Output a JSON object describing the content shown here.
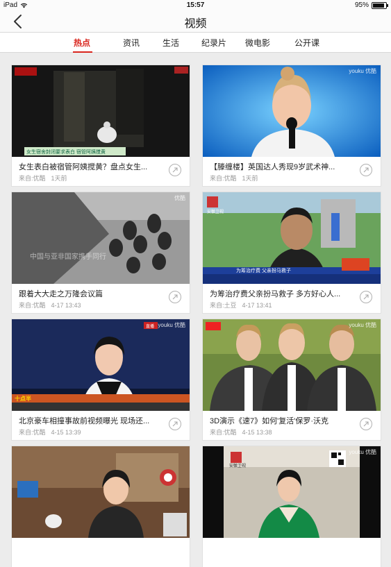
{
  "status": {
    "device": "iPad",
    "time": "15:57",
    "battery": "95%"
  },
  "nav": {
    "title": "视频",
    "back_icon": "chevron-left-icon"
  },
  "tabs": [
    {
      "label": "热点",
      "active": true
    },
    {
      "label": "资讯"
    },
    {
      "label": "生活"
    },
    {
      "label": "纪录片"
    },
    {
      "label": "微电影"
    },
    {
      "label": "公开课"
    }
  ],
  "accent_color": "#d9251d",
  "videos": [
    {
      "title": "女生表白被宿管阿姨搅黄？盘点女生...",
      "source": "来自:优酷",
      "time": "1天前",
      "caption": "女生宿舍封闭要求表白 宿管阿姨搅黄"
    },
    {
      "title": "【滕缠楼】英国达人秀现9岁武术神...",
      "source": "来自:优酷",
      "time": "1天前",
      "watermark": "youku 优酷"
    },
    {
      "title": "跟着大大走之万隆会议篇",
      "source": "来自:优酷",
      "time": "4-17 13:43",
      "watermark": "优酷",
      "caption": "中国与亚非国家携手同行"
    },
    {
      "title": "为筹治疗费父亲扮马救子 多方好心人...",
      "source": "来自:土豆",
      "time": "4-17 13:41",
      "channel": "安徽卫视",
      "caption": "为筹治疗费 父亲扮马救子"
    },
    {
      "title": "北京豪车相撞事故前视频曝光 现场还...",
      "source": "来自:优酷",
      "time": "4-15 13:39",
      "watermark": "youku 优酷",
      "badge": "直播",
      "caption": "十点半"
    },
    {
      "title": "3D演示《速7》如何'复活'保罗·沃克",
      "source": "来自:优酷",
      "time": "4-15 13:38",
      "watermark": "youku 优酷"
    },
    {
      "title": "",
      "source": "",
      "time": ""
    },
    {
      "title": "",
      "source": "",
      "time": "",
      "watermark": "youku 优酷",
      "channel": "安徽卫视"
    }
  ]
}
